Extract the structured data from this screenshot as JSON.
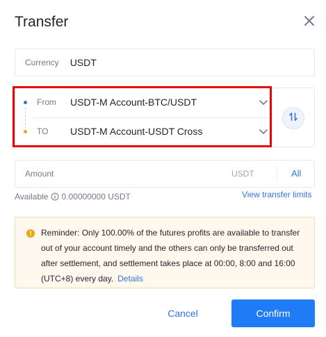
{
  "dialog": {
    "title": "Transfer"
  },
  "currency": {
    "label": "Currency",
    "value": "USDT"
  },
  "from": {
    "label": "From",
    "account": "USDT-M Account-BTC/USDT"
  },
  "to": {
    "label": "TO",
    "account": "USDT-M Account-USDT Cross"
  },
  "amount": {
    "placeholder": "Amount",
    "unit": "USDT",
    "all_label": "All"
  },
  "available": {
    "label": "Available",
    "value": "0.00000000 USDT"
  },
  "links": {
    "view_limits": "View transfer limits"
  },
  "reminder": {
    "text": "Reminder: Only 100.00% of the futures profits are available to transfer out of your account timely and the others can only be transferred out after settlement, and settlement takes place at 00:00, 8:00 and 16:00 (UTC+8) every day.",
    "details_label": "Details"
  },
  "buttons": {
    "cancel": "Cancel",
    "confirm": "Confirm"
  },
  "icons": {
    "close": "close-icon",
    "swap": "swap-icon",
    "chevron": "chevron-down-icon",
    "info": "info-icon",
    "warning": "warning-icon"
  },
  "colors": {
    "accent": "#1f7cf6",
    "link": "#3375e0",
    "from_dot": "#3375e0",
    "to_dot": "#f0a30a",
    "highlight_outline": "#e8000b",
    "reminder_bg": "#fff8ee"
  }
}
